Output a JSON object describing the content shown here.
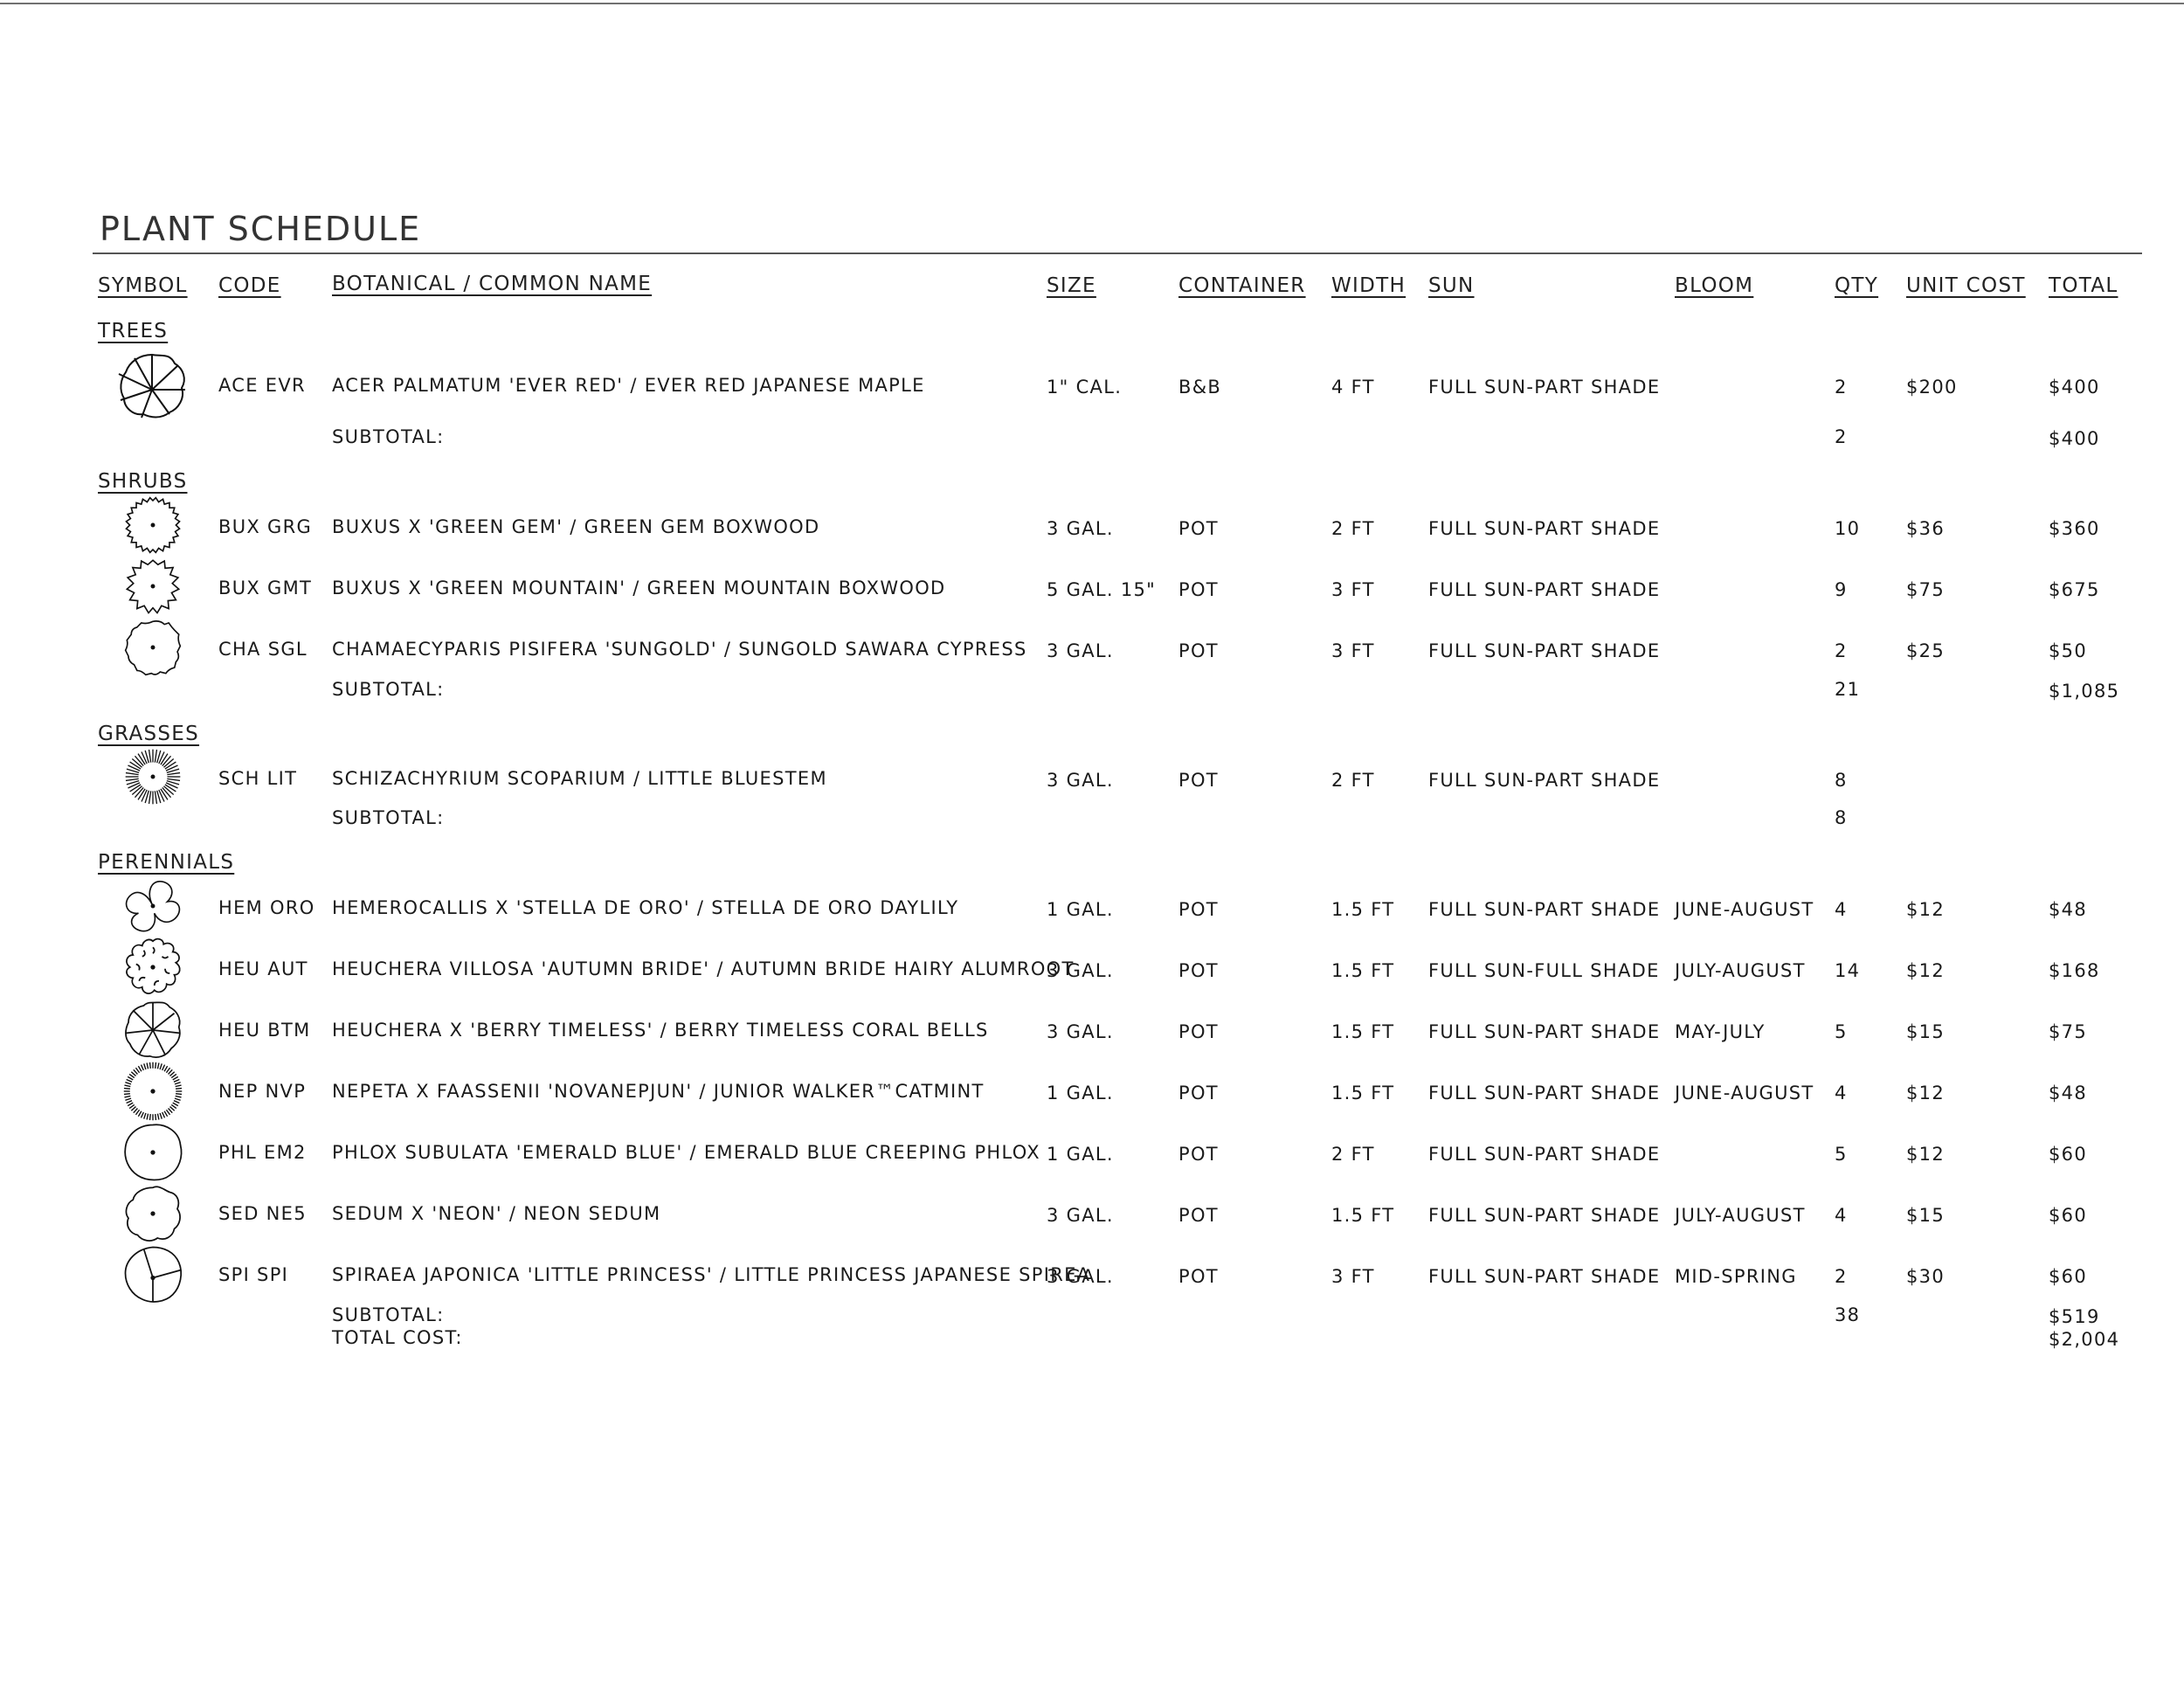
{
  "title": "PLANT SCHEDULE",
  "headers": {
    "symbol": "SYMBOL",
    "code": "CODE",
    "name": "BOTANICAL / COMMON NAME",
    "size": "SIZE",
    "container": "CONTAINER",
    "width": "WIDTH",
    "sun": "SUN",
    "bloom": "BLOOM",
    "qty": "QTY",
    "unit_cost": "UNIT COST",
    "total": "TOTAL"
  },
  "categories": {
    "trees": "TREES",
    "shrubs": "SHRUBS",
    "grasses": "GRASSES",
    "perennials": "PERENNIALS"
  },
  "rows": [
    {
      "symbol_icon": "maple-tree-symbol",
      "code": "ACE EVR",
      "name": "ACER PALMATUM 'EVER RED' / EVER RED JAPANESE MAPLE",
      "size": "1\" CAL.",
      "container": "B&B",
      "width": "4 FT",
      "sun": "FULL SUN-PART SHADE",
      "bloom": "",
      "qty": "2",
      "unit_cost": "$200",
      "total": "$400"
    },
    {
      "symbol_icon": "boxwood-shrub-symbol",
      "code": "BUX GRG",
      "name": "BUXUS X 'GREEN GEM' / GREEN GEM BOXWOOD",
      "size": "3 GAL.",
      "container": "POT",
      "width": "2 FT",
      "sun": "FULL SUN-PART SHADE",
      "bloom": "",
      "qty": "10",
      "unit_cost": "$36",
      "total": "$360"
    },
    {
      "symbol_icon": "boxwood-shrub-symbol",
      "code": "BUX GMT",
      "name": "BUXUS X 'GREEN MOUNTAIN' / GREEN MOUNTAIN BOXWOOD",
      "size": "5 GAL. 15\"",
      "container": "POT",
      "width": "3 FT",
      "sun": "FULL SUN-PART SHADE",
      "bloom": "",
      "qty": "9",
      "unit_cost": "$75",
      "total": "$675"
    },
    {
      "symbol_icon": "cypress-shrub-symbol",
      "code": "CHA SGL",
      "name": "CHAMAECYPARIS PISIFERA 'SUNGOLD' / SUNGOLD SAWARA CYPRESS",
      "size": "3 GAL.",
      "container": "POT",
      "width": "3 FT",
      "sun": "FULL SUN-PART SHADE",
      "bloom": "",
      "qty": "2",
      "unit_cost": "$25",
      "total": "$50"
    },
    {
      "symbol_icon": "grass-burst-symbol",
      "code": "SCH LIT",
      "name": "SCHIZACHYRIUM SCOPARIUM / LITTLE BLUESTEM",
      "size": "3 GAL.",
      "container": "POT",
      "width": "2 FT",
      "sun": "FULL SUN-PART SHADE",
      "bloom": "",
      "qty": "8",
      "unit_cost": "",
      "total": ""
    },
    {
      "symbol_icon": "daylily-symbol",
      "code": "HEM ORO",
      "name": "HEMEROCALLIS X 'STELLA DE ORO' / STELLA DE ORO DAYLILY",
      "size": "1 GAL.",
      "container": "POT",
      "width": "1.5 FT",
      "sun": "FULL SUN-PART SHADE",
      "bloom": "JUNE-AUGUST",
      "qty": "4",
      "unit_cost": "$12",
      "total": "$48"
    },
    {
      "symbol_icon": "heuchera-scalloped-symbol",
      "code": "HEU AUT",
      "name": "HEUCHERA VILLOSA 'AUTUMN BRIDE' / AUTUMN BRIDE HAIRY ALUMROOT",
      "size": "3 GAL.",
      "container": "POT",
      "width": "1.5 FT",
      "sun": "FULL SUN-FULL SHADE",
      "bloom": "JULY-AUGUST",
      "qty": "14",
      "unit_cost": "$12",
      "total": "$168"
    },
    {
      "symbol_icon": "coral-bells-symbol",
      "code": "HEU BTM",
      "name": "HEUCHERA X 'BERRY TIMELESS' / BERRY TIMELESS CORAL BELLS",
      "size": "3 GAL.",
      "container": "POT",
      "width": "1.5 FT",
      "sun": "FULL SUN-PART SHADE",
      "bloom": "MAY-JULY",
      "qty": "5",
      "unit_cost": "$15",
      "total": "$75"
    },
    {
      "symbol_icon": "catmint-symbol",
      "code": "NEP NVP",
      "name": "NEPETA X FAASSENII 'NOVANEPJUN' / JUNIOR WALKER™CATMINT",
      "size": "1 GAL.",
      "container": "POT",
      "width": "1.5 FT",
      "sun": "FULL SUN-PART SHADE",
      "bloom": "JUNE-AUGUST",
      "qty": "4",
      "unit_cost": "$12",
      "total": "$48"
    },
    {
      "symbol_icon": "phlox-symbol",
      "code": "PHL EM2",
      "name": "PHLOX SUBULATA 'EMERALD BLUE' / EMERALD BLUE CREEPING PHLOX",
      "size": "1 GAL.",
      "container": "POT",
      "width": "2 FT",
      "sun": "FULL SUN-PART SHADE",
      "bloom": "",
      "qty": "5",
      "unit_cost": "$12",
      "total": "$60"
    },
    {
      "symbol_icon": "sedum-symbol",
      "code": "SED NE5",
      "name": "SEDUM X 'NEON' / NEON SEDUM",
      "size": "3 GAL.",
      "container": "POT",
      "width": "1.5 FT",
      "sun": "FULL SUN-PART SHADE",
      "bloom": "JULY-AUGUST",
      "qty": "4",
      "unit_cost": "$15",
      "total": "$60"
    },
    {
      "symbol_icon": "spirea-symbol",
      "code": "SPI SPI",
      "name": "SPIRAEA JAPONICA 'LITTLE PRINCESS' / LITTLE PRINCESS JAPANESE SPIREA",
      "size": "3 GAL.",
      "container": "POT",
      "width": "3 FT",
      "sun": "FULL SUN-PART SHADE",
      "bloom": "MID-SPRING",
      "qty": "2",
      "unit_cost": "$30",
      "total": "$60"
    }
  ],
  "subtotals": [
    {
      "label": "SUBTOTAL:",
      "qty": "2",
      "total": "$400"
    },
    {
      "label": "SUBTOTAL:",
      "qty": "21",
      "total": "$1,085"
    },
    {
      "label": "SUBTOTAL:",
      "qty": "8",
      "total": ""
    },
    {
      "label": "SUBTOTAL:",
      "qty": "38",
      "total": "$519"
    }
  ],
  "grand_total": {
    "label": "TOTAL COST:",
    "total": "$2,004"
  }
}
